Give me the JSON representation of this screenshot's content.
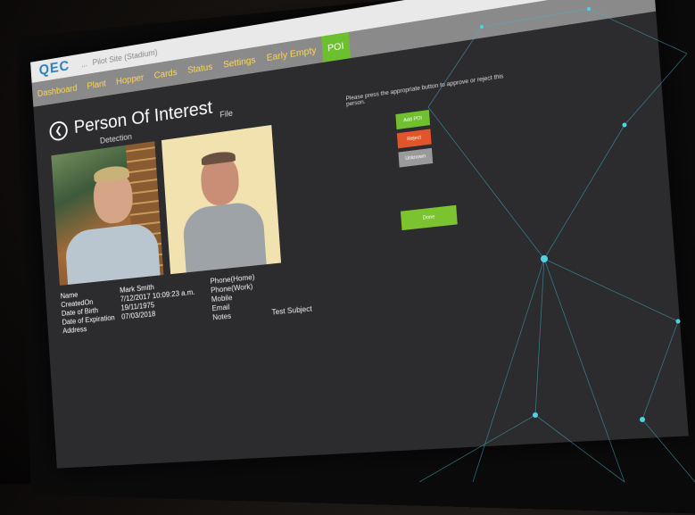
{
  "app": {
    "logo": "QEC",
    "site_small": "...",
    "window_title": "Pilot Site (Stadium)"
  },
  "nav": {
    "items": [
      "Dashboard",
      "Plant",
      "Hopper",
      "Cards",
      "Status",
      "Settings",
      "Early Empty",
      "POI"
    ],
    "active_index": 7
  },
  "page": {
    "title": "Person Of Interest",
    "detection_label": "Detection",
    "file_label": "File"
  },
  "person": {
    "labels": [
      "Name",
      "CreatedOn",
      "Date of Birth",
      "Date of Expiration",
      "Address"
    ],
    "values": [
      "Mark Smith",
      "7/12/2017 10:09:23 a.m.",
      "19/11/1975",
      "07/03/2018",
      ""
    ]
  },
  "contact": {
    "labels": [
      "Phone(Home)",
      "Phone(Work)",
      "Mobile",
      "Email",
      "Notes"
    ],
    "values": [
      "",
      "",
      "",
      "",
      "Test Subject"
    ]
  },
  "actions": {
    "prompt": "Please press the appropriate button to approve or reject this person.",
    "buttons": [
      "Add POI",
      "Reject",
      "Unknown"
    ],
    "primary": "Done"
  },
  "colors": {
    "accent_green": "#6cbf2f",
    "nav_text": "#ffd64a",
    "reject": "#e2542a",
    "network_line": "#3fb7c9"
  }
}
